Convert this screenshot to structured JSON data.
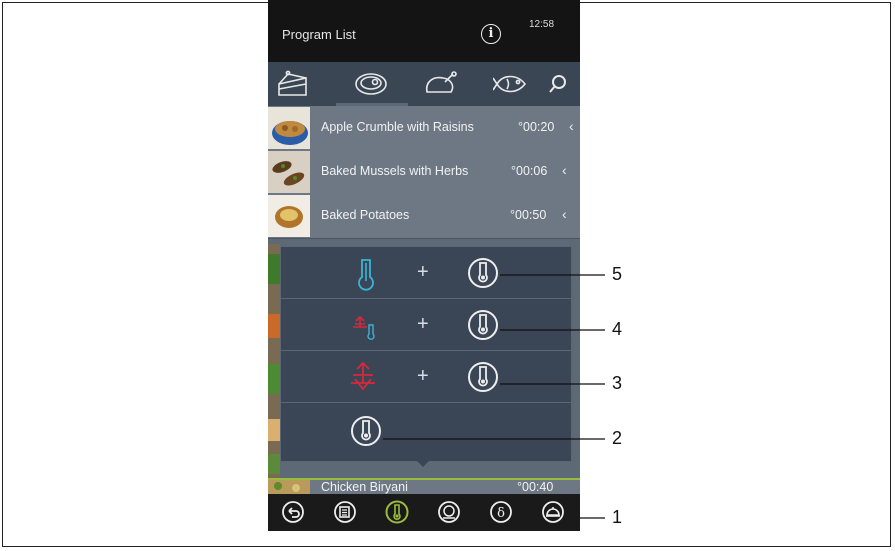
{
  "header": {
    "title": "Program List",
    "time": "12:58",
    "info_icon": "info-icon"
  },
  "categories": [
    "cake-icon",
    "meat-icon",
    "poultry-icon",
    "fish-icon",
    "search-icon"
  ],
  "programs": [
    {
      "name": "Apple Crumble with Raisins",
      "time": "°00:20",
      "thumb": "apple-crumble"
    },
    {
      "name": "Baked Mussels with Herbs",
      "time": "°00:06",
      "thumb": "baked-mussels"
    },
    {
      "name": "Baked Potatoes",
      "time": "°00:50",
      "thumb": "baked-potatoes"
    },
    {
      "name": "Chicken Biryani",
      "time": "°00:40",
      "thumb": "chicken-biryani"
    }
  ],
  "popup_options": [
    {
      "heat": "core-probe-icon",
      "combo": "plus"
    },
    {
      "heat": "steam-probe-icon",
      "combo": "plus"
    },
    {
      "heat": "steam-icon",
      "combo": "plus"
    },
    {
      "heat": "none",
      "combo": "none"
    }
  ],
  "popup_plus": "+",
  "bottom_nav": [
    "back-icon",
    "program-icon",
    "probe-icon",
    "plate-icon",
    "delta-icon",
    "cloche-icon"
  ],
  "callout_numbers": [
    "5",
    "4",
    "3",
    "2",
    "1"
  ],
  "colors": {
    "accent_green": "#9bbc3b",
    "probe_blue": "#3ab3d6",
    "steam_red": "#d8283b"
  }
}
